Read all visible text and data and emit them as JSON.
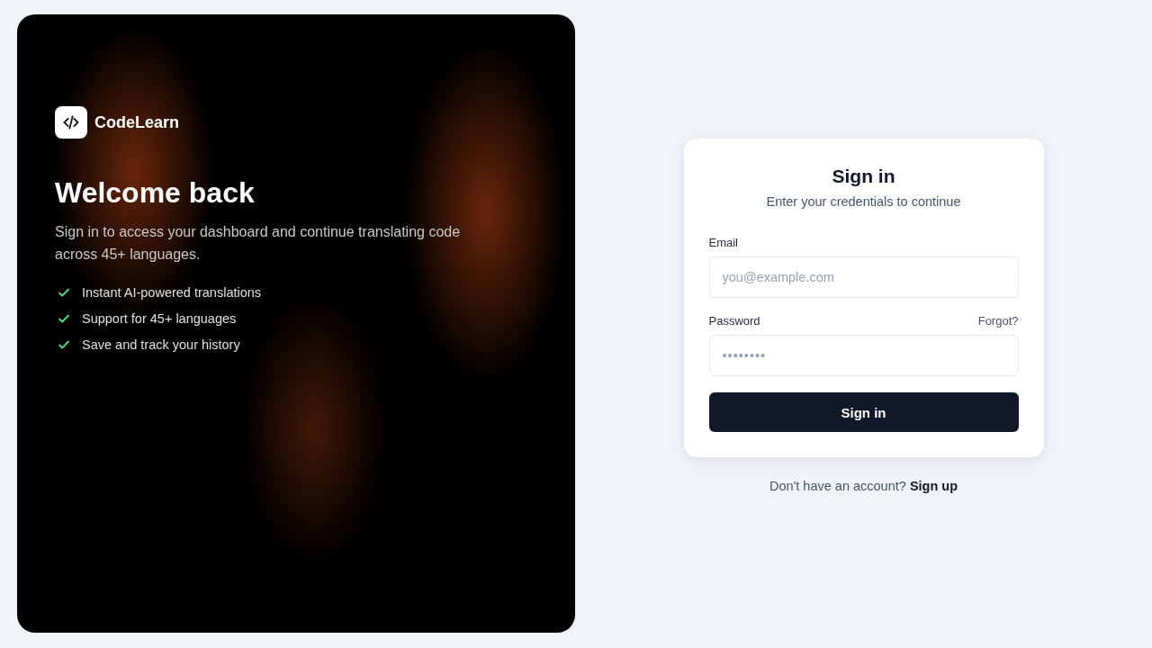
{
  "brand": {
    "name": "CodeLearn"
  },
  "hero": {
    "title": "Welcome back",
    "subtitle": "Sign in to access your dashboard and continue translating code across 45+ languages.",
    "features": [
      "Instant AI-powered translations",
      "Support for 45+ languages",
      "Save and track your history"
    ]
  },
  "form": {
    "title": "Sign in",
    "subtitle": "Enter your credentials to continue",
    "fields": [
      {
        "label": "Email",
        "placeholder": "you@example.com",
        "kind": "email"
      },
      {
        "label": "Password",
        "placeholder": "••••••••",
        "kind": "password",
        "link": "Forgot?"
      }
    ],
    "submit": "Sign in"
  },
  "footer": {
    "text": "Don't have an account?",
    "link": "Sign up"
  }
}
